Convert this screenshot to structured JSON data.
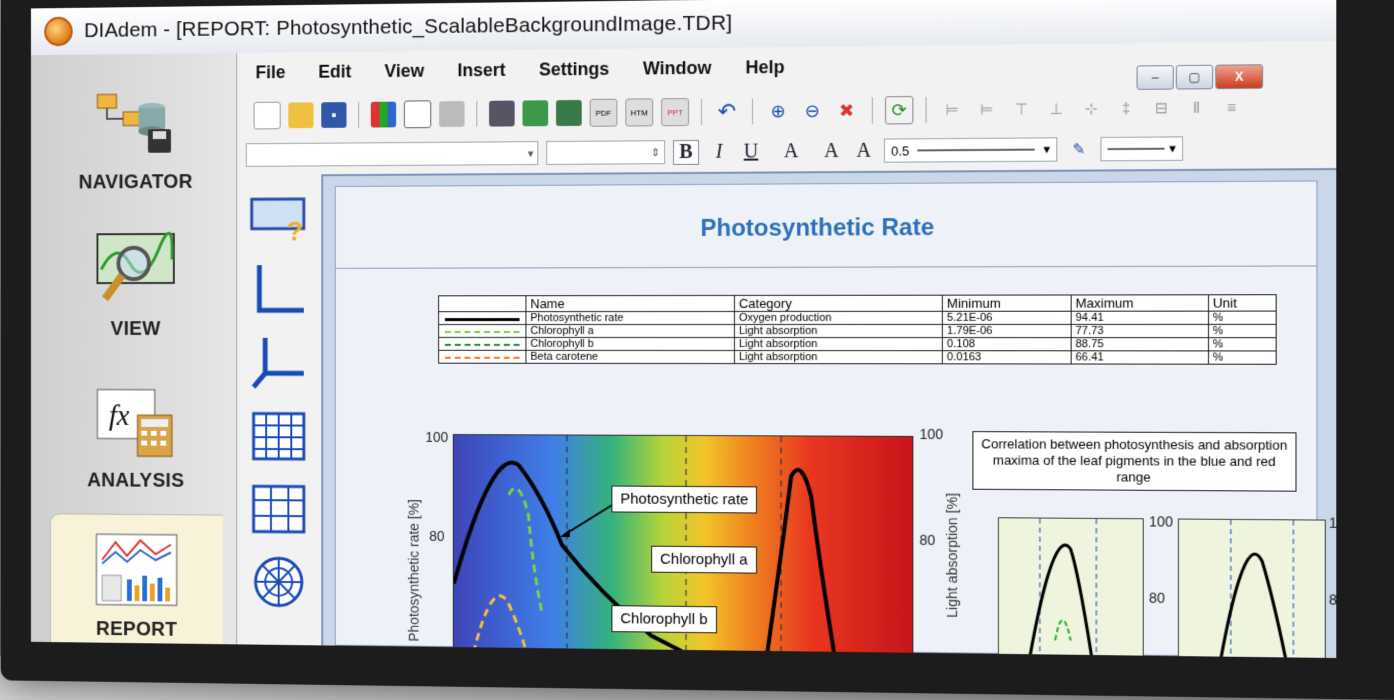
{
  "window": {
    "title": "DIAdem - [REPORT:  Photosynthetic_ScalableBackgroundImage.TDR]",
    "controls": [
      "–",
      "▢",
      "X"
    ]
  },
  "nav": [
    {
      "label": "NAVIGATOR",
      "icon": "navigator-icon"
    },
    {
      "label": "VIEW",
      "icon": "view-icon"
    },
    {
      "label": "ANALYSIS",
      "icon": "analysis-icon"
    },
    {
      "label": "REPORT",
      "icon": "report-icon",
      "active": true
    }
  ],
  "menu": [
    "File",
    "Edit",
    "View",
    "Insert",
    "Settings",
    "Window",
    "Help"
  ],
  "toolbar": {
    "line_width": "0.5",
    "format_buttons": [
      "B",
      "I",
      "U",
      "A",
      "A",
      "A"
    ]
  },
  "palette": [
    "graph-2d-icon",
    "axis-2d-icon",
    "axis-3d-icon",
    "table-icon",
    "table-icon",
    "polar-icon"
  ],
  "report": {
    "title": "Photosynthetic Rate",
    "legend_headers": [
      "Name",
      "Category",
      "Minimum",
      "Maximum",
      "Unit"
    ],
    "legend_rows": [
      {
        "name": "Photosynthetic rate",
        "category": "Oxygen production",
        "min": "5.21E-06",
        "max": "94.41",
        "unit": "%",
        "color": "#000000",
        "style": "solid"
      },
      {
        "name": "Chlorophyll a",
        "category": "Light absorption",
        "min": "1.79E-06",
        "max": "77.73",
        "unit": "%",
        "color": "#7ac943",
        "style": "dashed"
      },
      {
        "name": "Chlorophyll b",
        "category": "Light absorption",
        "min": "0.108",
        "max": "88.75",
        "unit": "%",
        "color": "#1a8a3a",
        "style": "dashed"
      },
      {
        "name": "Beta carotene",
        "category": "Light absorption",
        "min": "0.0163",
        "max": "66.41",
        "unit": "%",
        "color": "#f07a2a",
        "style": "dashed"
      }
    ],
    "chart": {
      "y_left_label": "Photosynthetic rate [%]",
      "y_right_label": "Light absorption [%]",
      "ticks": [
        "100",
        "80"
      ],
      "callouts": [
        "Photosynthetic rate",
        "Chlorophyll a",
        "Chlorophyll b"
      ]
    },
    "correlation_box": "Correlation between photosynthesis and absorption maxima of the leaf pigments in the blue and red range",
    "mini_tick": "100",
    "mini_tick2": "80"
  }
}
